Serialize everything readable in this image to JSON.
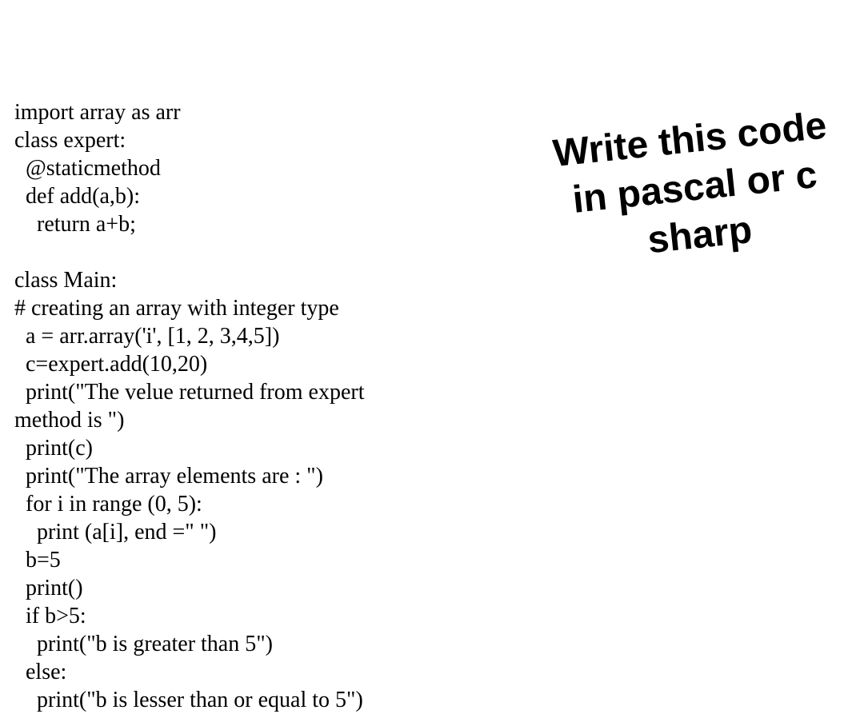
{
  "code": {
    "line01": "import array as arr",
    "line02": "class expert:",
    "line03": "  @staticmethod",
    "line04": "  def add(a,b):",
    "line05": "    return a+b;",
    "line06": "",
    "line07": "class Main:",
    "line08": "# creating an array with integer type",
    "line09": "  a = arr.array('i', [1, 2, 3,4,5])",
    "line10": "  c=expert.add(10,20)",
    "line11": "  print(\"The velue returned from expert",
    "line12": "method is \")",
    "line13": "  print(c)",
    "line14": "  print(\"The array elements are : \")",
    "line15": "  for i in range (0, 5):",
    "line16": "    print (a[i], end =\" \")",
    "line17": "  b=5",
    "line18": "  print()",
    "line19": "  if b>5:",
    "line20": "    print(\"b is greater than 5\")",
    "line21": "  else:",
    "line22": "    print(\"b is lesser than or equal to 5\")"
  },
  "annotation": {
    "line1": "Write this code",
    "line2": "in pascal or c",
    "line3": "sharp"
  }
}
